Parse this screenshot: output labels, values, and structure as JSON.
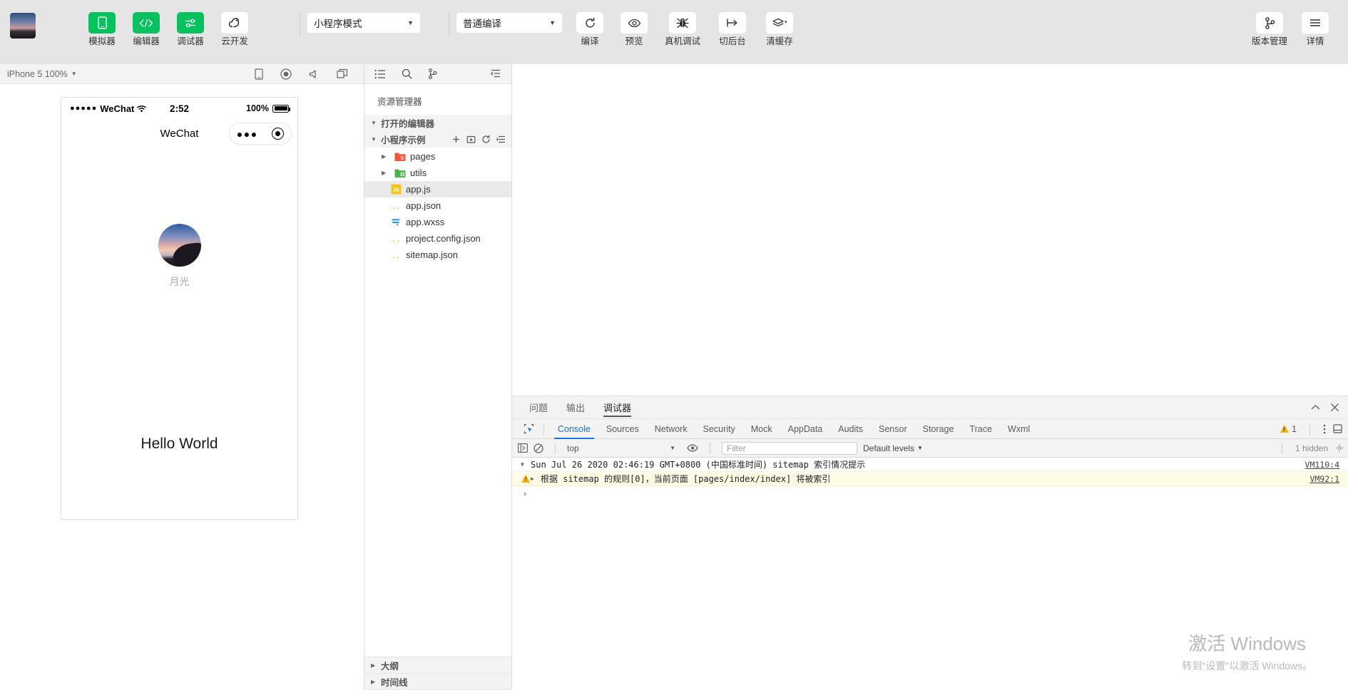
{
  "toolbar": {
    "logo_alt": "project-logo",
    "left_buttons": [
      {
        "label": "模拟器",
        "icon": "phone-icon",
        "active": true
      },
      {
        "label": "编辑器",
        "icon": "code-icon",
        "active": true
      },
      {
        "label": "调试器",
        "icon": "sliders-icon",
        "active": true
      },
      {
        "label": "云开发",
        "icon": "cloud-icon",
        "active": false
      }
    ],
    "mode_select": "小程序模式",
    "compile_select": "普通编译",
    "action_buttons": [
      {
        "label": "编译",
        "icon": "refresh-icon"
      },
      {
        "label": "预览",
        "icon": "eye-icon"
      },
      {
        "label": "真机调试",
        "icon": "bug-icon"
      },
      {
        "label": "切后台",
        "icon": "background-icon"
      },
      {
        "label": "清缓存",
        "icon": "layers-icon"
      }
    ],
    "right_buttons": [
      {
        "label": "版本管理",
        "icon": "git-branch-icon"
      },
      {
        "label": "详情",
        "icon": "hamburger-icon"
      }
    ]
  },
  "simulator": {
    "device": "iPhone 5 100%",
    "bar_icons": [
      "rotate-device-icon",
      "record-icon",
      "volume-icon",
      "windows-icon"
    ],
    "phone": {
      "status": {
        "dots": "●●●●●",
        "carrier": "WeChat",
        "wifi_icon": "wifi-icon",
        "time": "2:52",
        "battery": "100%"
      },
      "nav_title": "WeChat",
      "capsule": {
        "dots": "●●●",
        "target_icon": "target-icon"
      },
      "avatar_alt": "user-avatar",
      "username": "月光",
      "content": "Hello World"
    }
  },
  "explorer": {
    "icon_bar": [
      "list-icon",
      "search-icon",
      "git-branch-icon",
      "collapse-icon"
    ],
    "title": "资源管理器",
    "open_editors": "打开的编辑器",
    "project": "小程序示例",
    "project_actions": [
      "new-file-icon",
      "new-folder-icon",
      "refresh-icon",
      "collapse-all-icon"
    ],
    "tree": [
      {
        "name": "pages",
        "type": "folder",
        "icon": "folder-pages-icon",
        "expandable": true,
        "selected": false
      },
      {
        "name": "utils",
        "type": "folder",
        "icon": "folder-utils-icon",
        "expandable": true,
        "selected": false
      },
      {
        "name": "app.js",
        "type": "file",
        "icon": "js-icon",
        "expandable": false,
        "selected": true
      },
      {
        "name": "app.json",
        "type": "file",
        "icon": "json-icon",
        "expandable": false,
        "selected": false
      },
      {
        "name": "app.wxss",
        "type": "file",
        "icon": "wxss-icon",
        "expandable": false,
        "selected": false
      },
      {
        "name": "project.config.json",
        "type": "file",
        "icon": "json-icon",
        "expandable": false,
        "selected": false
      },
      {
        "name": "sitemap.json",
        "type": "file",
        "icon": "json-icon",
        "expandable": false,
        "selected": false
      }
    ],
    "bottom_sections": [
      "大纲",
      "时间线"
    ]
  },
  "debugger": {
    "panel_tabs": [
      {
        "label": "问题",
        "active": false
      },
      {
        "label": "输出",
        "active": false
      },
      {
        "label": "调试器",
        "active": true
      }
    ],
    "panel_controls": [
      "collapse-icon",
      "close-icon"
    ],
    "devtools_tabs": [
      {
        "label": "Console",
        "active": true
      },
      {
        "label": "Sources",
        "active": false
      },
      {
        "label": "Network",
        "active": false
      },
      {
        "label": "Security",
        "active": false
      },
      {
        "label": "Mock",
        "active": false
      },
      {
        "label": "AppData",
        "active": false
      },
      {
        "label": "Audits",
        "active": false
      },
      {
        "label": "Sensor",
        "active": false
      },
      {
        "label": "Storage",
        "active": false
      },
      {
        "label": "Trace",
        "active": false
      },
      {
        "label": "Wxml",
        "active": false
      }
    ],
    "warning_count": "1",
    "console_toolbar": {
      "context": "top",
      "filter_placeholder": "Filter",
      "levels": "Default levels",
      "hidden_count": "1 hidden"
    },
    "logs": [
      {
        "kind": "group",
        "arrow": "▼",
        "text": "Sun Jul 26 2020 02:46:19 GMT+0800 (中国标准时间) sitemap 索引情况提示",
        "source": "VM110:4"
      },
      {
        "kind": "warning",
        "arrow": "▶",
        "text": "根据 sitemap 的规则[0]，当前页面 [pages/index/index] 将被索引",
        "source": "VM92:1"
      }
    ],
    "prompt": "›"
  },
  "watermark": {
    "line1": "激活 Windows",
    "line2": "转到\"设置\"以激活 Windows。"
  },
  "colors": {
    "accent_green": "#07c160",
    "toolbar_bg": "#e5e5e5",
    "devtools_blue": "#1a73e8",
    "warn_yellow": "#f5b400"
  }
}
